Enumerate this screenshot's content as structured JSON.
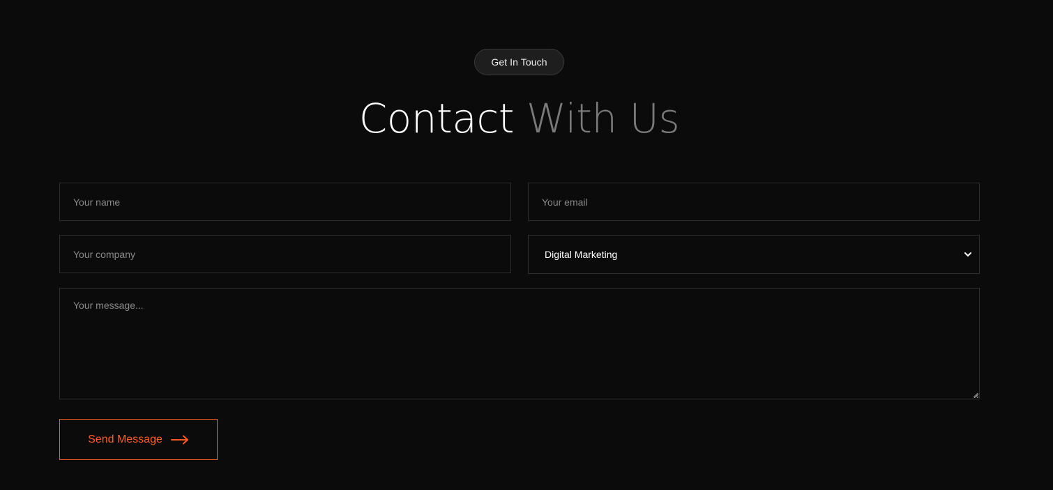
{
  "badge": {
    "label": "Get In Touch"
  },
  "heading": {
    "part1": "Contact",
    "part2": "With Us"
  },
  "form": {
    "name_placeholder": "Your name",
    "email_placeholder": "Your email",
    "company_placeholder": "Your company",
    "service_selected": "Digital Marketing",
    "message_placeholder": "Your message...",
    "send_label": "Send Message"
  },
  "icons": {
    "select_chevron": "chevron-down-icon",
    "send_arrow": "arrow-right-icon",
    "resize_grip": "resize-grip-icon"
  },
  "colors": {
    "background": "#0b0b0b",
    "accent": "#ff5a1f",
    "muted_heading": "#7a7a7a",
    "border": "#2e2e2e"
  }
}
